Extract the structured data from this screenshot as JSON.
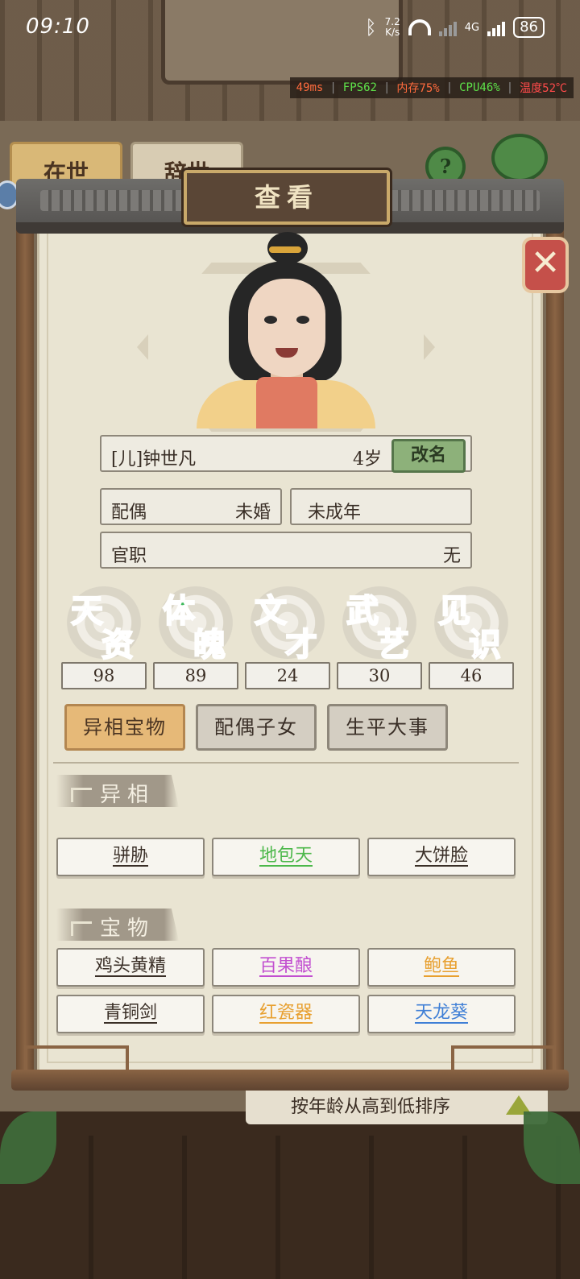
{
  "status_bar": {
    "time": "09:10",
    "net_speed_value": "7.2",
    "net_speed_unit": "K/s",
    "network_type": "4G",
    "battery": "86",
    "icons": [
      "bluetooth-icon",
      "wifi-icon",
      "signal-icon",
      "battery-icon"
    ]
  },
  "perf_overlay": {
    "ping": "49ms",
    "fps": "FPS62",
    "memory": "内存75%",
    "cpu": "CPU46%",
    "temperature": "温度52℃",
    "colors": {
      "ping": "#ff6b3d",
      "fps": "#5ee24a",
      "memory": "#ff6b3d",
      "cpu": "#5ee24a",
      "temperature": "#ff4a4a"
    }
  },
  "background": {
    "tab_alive": "在世",
    "tab_deceased": "辞世",
    "help_icon": "?",
    "sort_label": "按年龄从高到低排序"
  },
  "modal": {
    "title": "查看",
    "close_icon": "✕",
    "character": {
      "name": "[儿]钟世凡",
      "age": "4岁",
      "rename_label": "改名",
      "spouse_label": "配偶",
      "spouse_value": "未婚",
      "adult_status": "未成年",
      "office_label": "官职",
      "office_value": "无"
    },
    "stats": [
      {
        "c1": "天",
        "c2": "资",
        "value": "98",
        "color": "#3f7fd6"
      },
      {
        "c1": "体",
        "c2": "魄",
        "value": "89",
        "color": "#3cb85b"
      },
      {
        "c1": "文",
        "c2": "才",
        "value": "24",
        "color": "#b04fd0"
      },
      {
        "c1": "武",
        "c2": "艺",
        "value": "30",
        "color": "#e0a33a"
      },
      {
        "c1": "见",
        "c2": "识",
        "value": "46",
        "color": "#e06a5e"
      }
    ],
    "tabs": [
      {
        "label": "异相宝物",
        "active": true
      },
      {
        "label": "配偶子女",
        "active": false
      },
      {
        "label": "生平大事",
        "active": false
      }
    ],
    "traits_heading": "异相",
    "traits": [
      {
        "label": "骈胁",
        "color": "#3a2f27"
      },
      {
        "label": "地包天",
        "color": "#4cb84a"
      },
      {
        "label": "大饼脸",
        "color": "#3a2f27"
      }
    ],
    "treasures_heading": "宝物",
    "treasures": [
      {
        "label": "鸡头黄精",
        "color": "#3a2f27"
      },
      {
        "label": "百果酿",
        "color": "#c24fd0"
      },
      {
        "label": "鲍鱼",
        "color": "#e8a030"
      },
      {
        "label": "青铜剑",
        "color": "#3a2f27"
      },
      {
        "label": "红瓷器",
        "color": "#e8a030"
      },
      {
        "label": "天龙葵",
        "color": "#3f7fd6"
      }
    ]
  }
}
